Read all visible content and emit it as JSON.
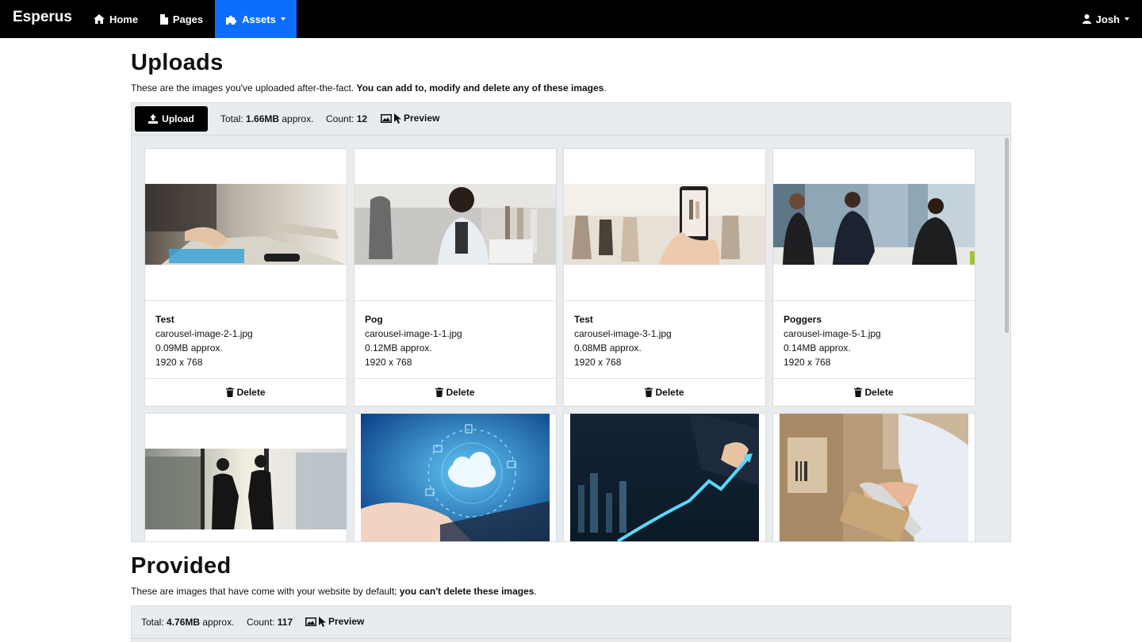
{
  "nav": {
    "brand": "Esperus",
    "home": "Home",
    "pages": "Pages",
    "assets": "Assets",
    "user": "Josh"
  },
  "uploads": {
    "title": "Uploads",
    "lead_plain": "These are the images you've uploaded after-the-fact. ",
    "lead_bold": "You can add to, modify and delete any of these images",
    "lead_end": ".",
    "upload_label": "Upload",
    "total_label": "Total: ",
    "total_value": "1.66MB",
    "total_suffix": " approx.",
    "count_label": "Count: ",
    "count_value": "12",
    "preview_label": "Preview",
    "delete_label": "Delete",
    "items": [
      {
        "title": "Test",
        "file": "carousel-image-2-1.jpg",
        "size": "0.09MB approx.",
        "dims": "1920 x 768"
      },
      {
        "title": "Pog",
        "file": "carousel-image-1-1.jpg",
        "size": "0.12MB approx.",
        "dims": "1920 x 768"
      },
      {
        "title": "Test",
        "file": "carousel-image-3-1.jpg",
        "size": "0.08MB approx.",
        "dims": "1920 x 768"
      },
      {
        "title": "Poggers",
        "file": "carousel-image-5-1.jpg",
        "size": "0.14MB approx.",
        "dims": "1920 x 768"
      }
    ]
  },
  "provided": {
    "title": "Provided",
    "lead_plain": "These are images that have come with your website by default; ",
    "lead_bold": "you can't delete these images",
    "lead_end": ".",
    "total_label": "Total: ",
    "total_value": "4.76MB",
    "total_suffix": " approx.",
    "count_label": "Count: ",
    "count_value": "117",
    "preview_label": "Preview"
  },
  "colors": {
    "navbar": "#000000",
    "active_nav": "#0d6efd",
    "panel": "#e9ecef",
    "primary_button": "#000000"
  },
  "icons": [
    "home-icon",
    "file-icon",
    "puzzle-icon",
    "user-icon",
    "upload-icon",
    "image-icon",
    "cursor-icon",
    "trash-icon"
  ]
}
